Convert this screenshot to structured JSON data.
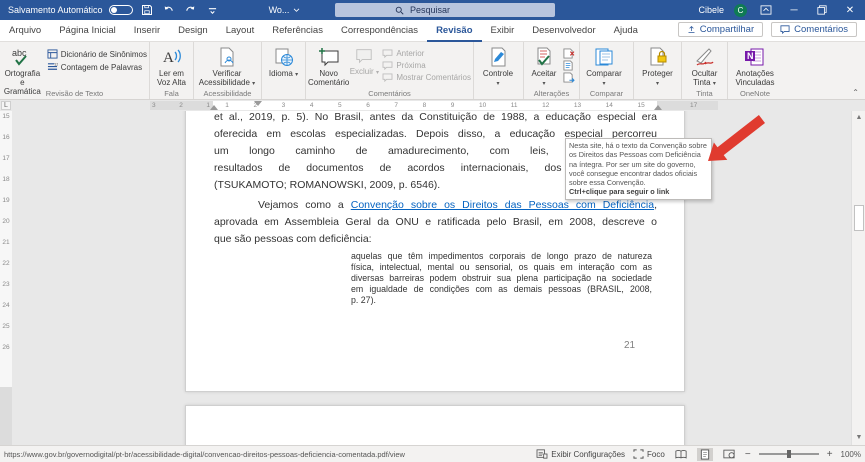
{
  "titlebar": {
    "autosave": "Salvamento Automático",
    "doc_title": "Wo...",
    "search_placeholder": "Pesquisar",
    "user": "Cibele",
    "user_initial": "C"
  },
  "tabs": {
    "items": [
      "Arquivo",
      "Página Inicial",
      "Inserir",
      "Design",
      "Layout",
      "Referências",
      "Correspondências",
      "Revisão",
      "Exibir",
      "Desenvolvedor",
      "Ajuda"
    ],
    "share": "Compartilhar",
    "comments": "Comentários"
  },
  "ribbon": {
    "spelling": "Ortografia e Gramática",
    "thesaurus": "Dicionário de Sinônimos",
    "word_count": "Contagem de Palavras",
    "group_proofing": "Revisão de Texto",
    "read_aloud": "Ler em Voz Alta",
    "group_speech": "Fala",
    "check_accessibility": "Verificar Acessibilidade",
    "group_accessibility": "Acessibilidade",
    "language": "Idioma",
    "new_comment": "Novo Comentário",
    "delete_comment": "Excluir",
    "prev_comment": "Anterior",
    "next_comment": "Próxima",
    "show_comments": "Mostrar Comentários",
    "group_comments": "Comentários",
    "tracking": "Controle",
    "accept": "Aceitar",
    "group_changes": "Alterações",
    "compare": "Comparar",
    "group_compare": "Comparar",
    "protect": "Proteger",
    "hide_ink_1": "Ocultar",
    "hide_ink_2": "Tinta",
    "group_ink": "Tinta",
    "linked_notes": "Anotações Vinculadas",
    "group_onenote": "OneNote"
  },
  "ruler": {
    "h_left": [
      "3",
      "2",
      "1"
    ],
    "h_mid": [
      "1",
      "2",
      "3",
      "4",
      "5",
      "6",
      "7",
      "8",
      "9",
      "10",
      "11",
      "12",
      "13",
      "14",
      "15"
    ],
    "h_right": "17",
    "v_nums": [
      "15",
      "16",
      "17",
      "18",
      "19",
      "20",
      "21",
      "22",
      "23",
      "24",
      "25",
      "26"
    ]
  },
  "document": {
    "para1": [
      "et al., 2019, p. 5). No Brasil, antes da Constituição de 1988, a educação especial era",
      "oferecida em escolas especializadas. Depois disso, a educação especial percorreu",
      "um longo caminho de amadurecimento, com leis, decretos, diretr",
      "resultados de documentos de acordos internacionais, dos quais o Bra",
      "(TSUKAMOTO; ROMANOWSKI, 2009, p. 6546)."
    ],
    "para2_before": "Vejamos como a ",
    "para2_link": "Convenção sobre os Direitos das Pessoas com Deficiência",
    "para2_after": ",",
    "para2_line2": "aprovada em Assembleia Geral da ONU e ratificada pelo Brasil, em 2008, descreve o",
    "para2_line3": "que são pessoas com deficiência:",
    "quote": [
      "aquelas que têm impedimentos corporais de longo prazo de natureza",
      "física, intelectual, mental ou sensorial, os quais em interação com as",
      "diversas barreiras podem obstruir sua plena participação na sociedade",
      "em igualdade de condições com as demais pessoas (BRASIL, 2008,",
      "p. 27)."
    ],
    "page_number": "21"
  },
  "tooltip": {
    "lines": [
      "Nesta site, há o texto da Convenção sobre",
      "os Direitos das Pessoas com Deficiência",
      "na íntegra. Por ser um site do governo,",
      "você consegue encontrar dados oficiais",
      "sobre essa Convenção."
    ],
    "action": "Ctrl+clique para seguir o link"
  },
  "statusbar": {
    "url": "https://www.gov.br/governodigital/pt-br/acessibilidade-digital/convencao-direitos-pessoas-deficiencia-comentada.pdf/view",
    "display_settings": "Exibir Configurações",
    "focus": "Foco",
    "zoom_level": "100%"
  },
  "colors": {
    "titlebar_blue": "#2b579a",
    "link_blue": "#0563c1",
    "arrow_red": "#e03b2f",
    "avatar_green": "#0f7b55"
  }
}
